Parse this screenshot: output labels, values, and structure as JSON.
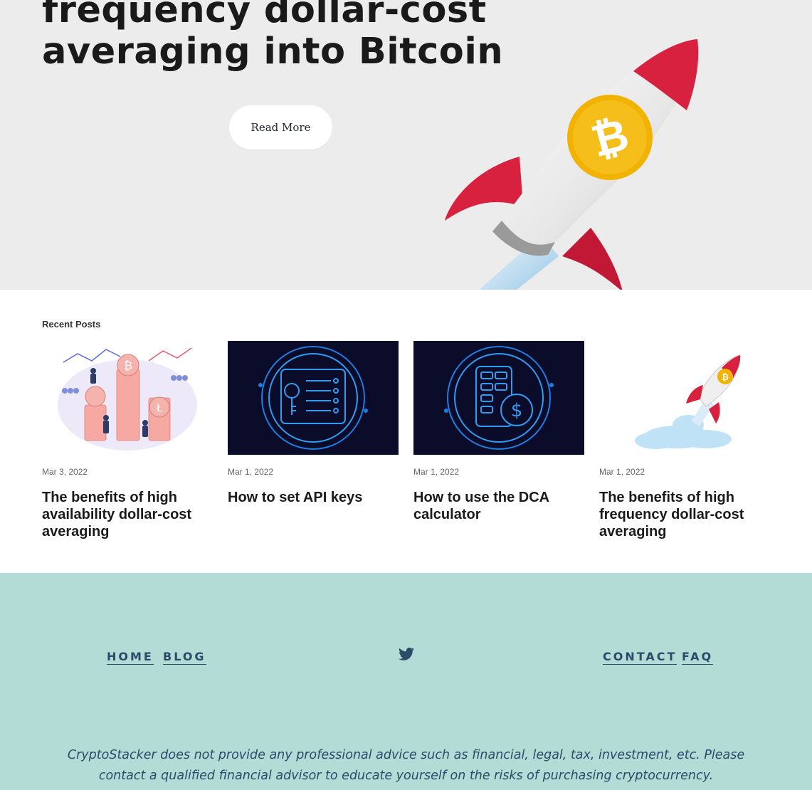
{
  "hero": {
    "title_lines": [
      "frequency dollar-cost",
      "averaging into Bitcoin"
    ],
    "read_more_label": "Read More"
  },
  "recent_posts": {
    "label": "Recent Posts",
    "posts": [
      {
        "date": "Mar 3, 2022",
        "title": "The benefits of high availability dollar-cost averaging",
        "image": "coins-illustration"
      },
      {
        "date": "Mar 1, 2022",
        "title": "How to set API keys",
        "image": "key-list-icon"
      },
      {
        "date": "Mar 1, 2022",
        "title": "How to use the DCA calculator",
        "image": "calculator-dollar-icon"
      },
      {
        "date": "Mar 1, 2022",
        "title": "The benefits of high frequency dollar-cost averaging",
        "image": "bitcoin-rocket"
      }
    ]
  },
  "footer": {
    "nav_left": [
      "HOME",
      "BLOG"
    ],
    "nav_right": [
      "CONTACT",
      "FAQ"
    ],
    "social_icon": "twitter-icon",
    "disclaimer": "CryptoStacker does not provide any professional advice such as financial, legal, tax, investment, etc. Please contact a qualified financial advisor to educate yourself on the risks of purchasing cryptocurrency."
  },
  "colors": {
    "hero_bg": "#ececec",
    "footer_bg": "#b2dcd5",
    "footer_text": "#2d4a6a",
    "thumb_dark": "#0b0b2a",
    "thumb_line": "#1e7de0",
    "rocket_red": "#d8203f",
    "bitcoin_gold": "#f2b300"
  }
}
